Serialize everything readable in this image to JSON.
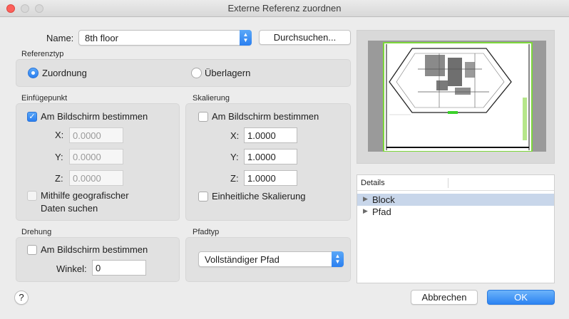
{
  "window": {
    "title": "Externe Referenz zuordnen"
  },
  "name": {
    "label": "Name:",
    "value": "8th floor",
    "browse_button": "Durchsuchen..."
  },
  "reference_type": {
    "heading": "Referenztyp",
    "options": [
      {
        "label": "Zuordnung",
        "selected": true
      },
      {
        "label": "Überlagern",
        "selected": false
      }
    ]
  },
  "insertion_point": {
    "heading": "Einfügepunkt",
    "specify_on_screen": {
      "label": "Am Bildschirm bestimmen",
      "checked": true
    },
    "x": {
      "label": "X:",
      "value": "0.0000"
    },
    "y": {
      "label": "Y:",
      "value": "0.0000"
    },
    "z": {
      "label": "Z:",
      "value": "0.0000"
    },
    "geo": {
      "label_line1": "Mithilfe geografischer",
      "label_line2": "Daten suchen",
      "checked": false
    }
  },
  "scale": {
    "heading": "Skalierung",
    "specify_on_screen": {
      "label": "Am Bildschirm bestimmen",
      "checked": false
    },
    "x": {
      "label": "X:",
      "value": "1.0000"
    },
    "y": {
      "label": "Y:",
      "value": "1.0000"
    },
    "z": {
      "label": "Z:",
      "value": "1.0000"
    },
    "uniform": {
      "label": "Einheitliche Skalierung",
      "checked": false
    }
  },
  "rotation": {
    "heading": "Drehung",
    "specify_on_screen": {
      "label": "Am Bildschirm bestimmen",
      "checked": false
    },
    "angle": {
      "label": "Winkel:",
      "value": "0"
    }
  },
  "path_type": {
    "heading": "Pfadtyp",
    "value": "Vollständiger Pfad"
  },
  "details": {
    "heading": "Details",
    "items": [
      {
        "label": "Block",
        "selected": true
      },
      {
        "label": "Pfad",
        "selected": false
      }
    ]
  },
  "buttons": {
    "help": "?",
    "cancel": "Abbrechen",
    "ok": "OK"
  },
  "colors": {
    "accent": "#2c83f2",
    "selection": "#c8d6ea",
    "close": "#fc605b"
  },
  "icons": {
    "popup_arrows": "updown-chevron-icon",
    "tree_toggle": "disclosure-triangle-icon",
    "checkmark": "checkmark-icon"
  }
}
